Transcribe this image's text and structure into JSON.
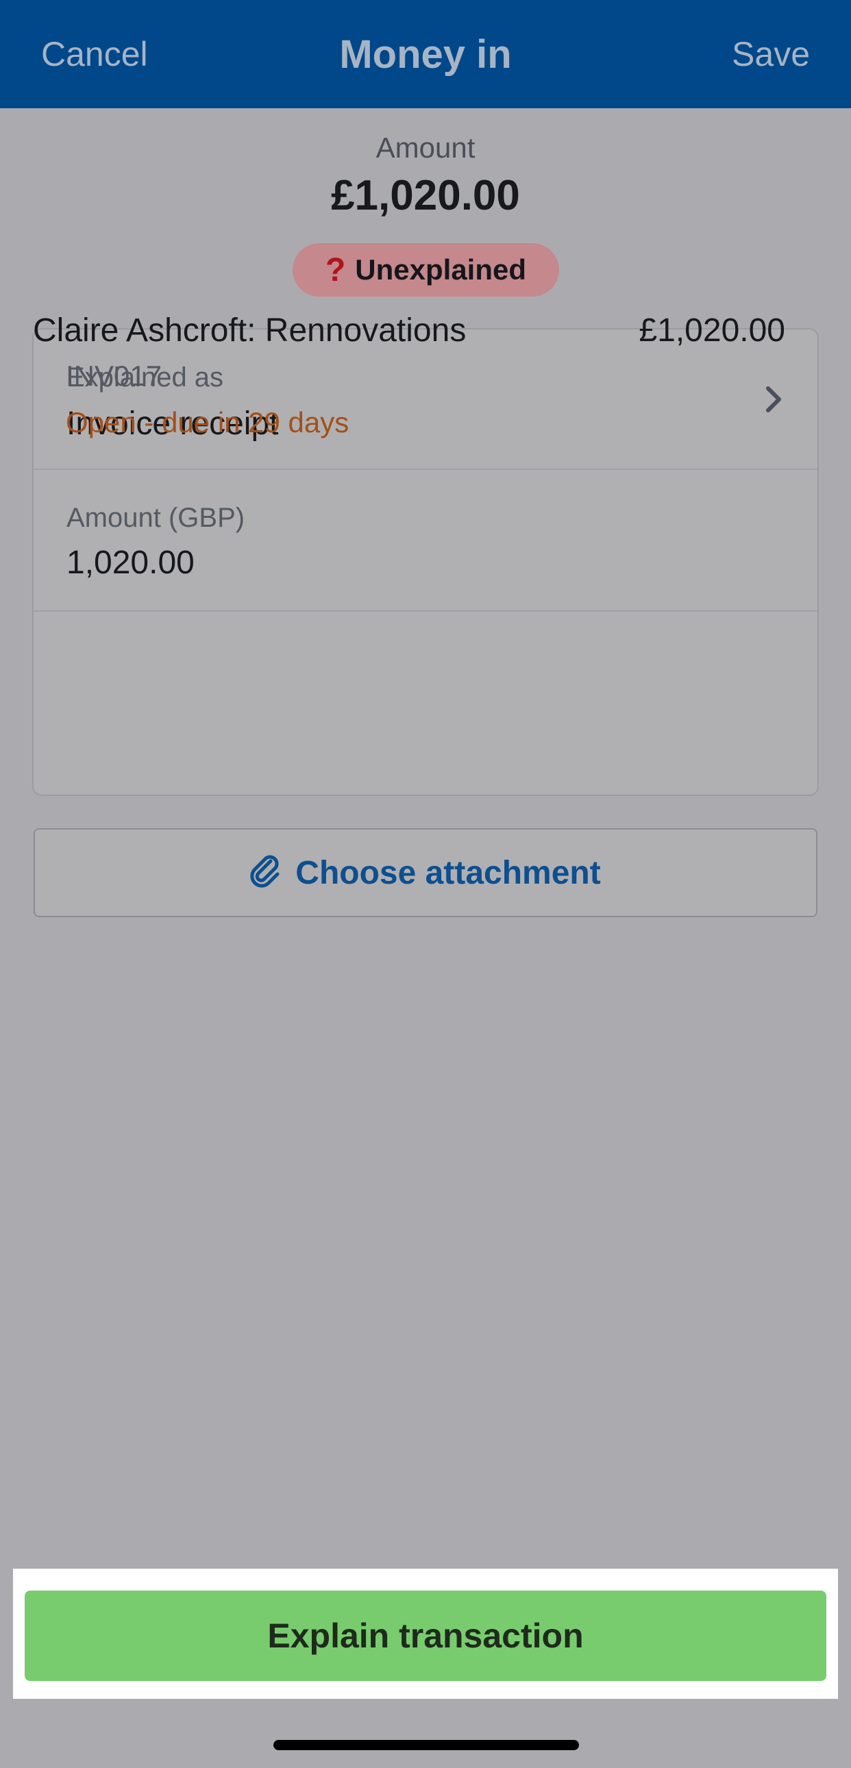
{
  "nav": {
    "cancel_label": "Cancel",
    "title": "Money in",
    "save_label": "Save"
  },
  "summary": {
    "amount_label": "Amount",
    "amount_value": "£1,020.00",
    "status_badge": "Unexplained",
    "status_icon": "question-mark-icon"
  },
  "form": {
    "explained_as_label": "Explained as",
    "explained_as_value": "Invoice receipt",
    "amount_gbp_label": "Amount (GBP)",
    "amount_gbp_value": "1,020.00",
    "invoice": {
      "name": "Claire Ashcroft: Rennovations",
      "amount": "£1,020.00",
      "reference": "INV017",
      "status": "Open - due in 29 days"
    }
  },
  "attachment": {
    "label": "Choose attachment",
    "icon": "paperclip-icon"
  },
  "footer": {
    "explain_label": "Explain transaction"
  },
  "colors": {
    "nav_background": "#00488a",
    "primary_action": "#78cc6e",
    "badge_background": "#c5888c",
    "status_warning": "#a2501a",
    "link": "#0d4f8f"
  }
}
